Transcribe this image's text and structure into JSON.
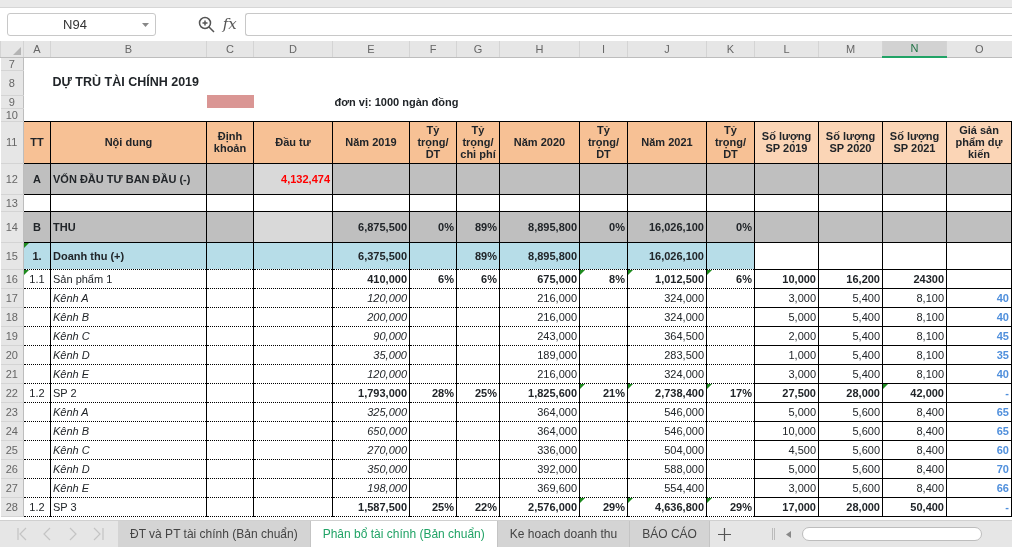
{
  "name_box": {
    "value": "N94"
  },
  "formula_bar": {
    "fx_label": "fx"
  },
  "columns": [
    {
      "label": "A",
      "selected": false
    },
    {
      "label": "B",
      "selected": false
    },
    {
      "label": "C",
      "selected": false
    },
    {
      "label": "D",
      "selected": false
    },
    {
      "label": "E",
      "selected": false
    },
    {
      "label": "F",
      "selected": false
    },
    {
      "label": "G",
      "selected": false
    },
    {
      "label": "H",
      "selected": false
    },
    {
      "label": "I",
      "selected": false
    },
    {
      "label": "J",
      "selected": false
    },
    {
      "label": "K",
      "selected": false
    },
    {
      "label": "L",
      "selected": false
    },
    {
      "label": "M",
      "selected": false
    },
    {
      "label": "N",
      "selected": true
    },
    {
      "label": "O",
      "selected": false
    }
  ],
  "rows": [
    {
      "number": "7",
      "kind": "spacer"
    },
    {
      "number": "8",
      "kind": "title",
      "text": "DỰ TRÙ TÀI CHÍNH 2019"
    },
    {
      "number": "9",
      "kind": "note",
      "text": "đơn vị: 1000 ngàn đồng"
    },
    {
      "number": "10",
      "kind": "spacer"
    },
    {
      "number": "11",
      "kind": "header",
      "cells": [
        {
          "text": "TT",
          "kind": "main"
        },
        {
          "text": "Nội dung",
          "kind": "main"
        },
        {
          "text": "Định khoản",
          "kind": "main"
        },
        {
          "text": "Đầu tư",
          "kind": "main"
        },
        {
          "text": "Năm 2019",
          "kind": "main"
        },
        {
          "text": "Tỷ trọng/ DT",
          "kind": "main"
        },
        {
          "text": "Tỷ trọng/ chi phí",
          "kind": "main"
        },
        {
          "text": "Năm 2020",
          "kind": "main"
        },
        {
          "text": "Tỷ trọng/ DT",
          "kind": "main"
        },
        {
          "text": "Năm 2021",
          "kind": "main"
        },
        {
          "text": "Tỷ trọng/ DT",
          "kind": "main"
        },
        {
          "text": "Số lượng SP 2019",
          "kind": "count"
        },
        {
          "text": "Số lượng SP 2020",
          "kind": "count"
        },
        {
          "text": "Số lượng SP 2021",
          "kind": "count"
        },
        {
          "text": "Giá sản phẩm dự kiến",
          "kind": "count"
        }
      ]
    },
    {
      "number": "12",
      "kind": "section",
      "cells": {
        "A": "A",
        "B": "VỐN ĐẦU TƯ BAN ĐẦU (-)",
        "D": "4,132,474"
      },
      "red": {
        "D": true
      }
    },
    {
      "number": "13",
      "kind": "blank",
      "cells": {}
    },
    {
      "number": "14",
      "kind": "section",
      "cells": {
        "A": "B",
        "B": "THU",
        "E": "6,875,500",
        "F": "0%",
        "G": "89%",
        "H": "8,895,800",
        "I": "0%",
        "J": "16,026,100",
        "K": "0%"
      }
    },
    {
      "number": "15",
      "kind": "subtotal",
      "cells": {
        "A": "1.",
        "B": "Doanh thu (+)",
        "E": "6,375,500",
        "G": "89%",
        "H": "8,895,800",
        "J": "16,026,100"
      },
      "flagged": {
        "A": true
      }
    },
    {
      "number": "16",
      "kind": "product",
      "cells": {
        "A": "1.1",
        "B": "Sản phẩm 1",
        "E": "410,000",
        "F": "6%",
        "G": "6%",
        "H": "675,000",
        "I": "8%",
        "J": "1,012,500",
        "K": "6%",
        "L": "10,000",
        "M": "16,200",
        "N": "24300"
      },
      "flagged": {
        "A": true,
        "I": true,
        "J": true,
        "K": true
      }
    },
    {
      "number": "17",
      "kind": "channel",
      "cells": {
        "B": "Kênh A",
        "E": "120,000",
        "H": "216,000",
        "J": "324,000",
        "L": "3,000",
        "M": "5,400",
        "N": "8,100",
        "O": "40"
      }
    },
    {
      "number": "18",
      "kind": "channel",
      "cells": {
        "B": "Kênh B",
        "E": "200,000",
        "H": "216,000",
        "J": "324,000",
        "L": "5,000",
        "M": "5,400",
        "N": "8,100",
        "O": "40"
      }
    },
    {
      "number": "19",
      "kind": "channel",
      "cells": {
        "B": "Kênh C",
        "E": "90,000",
        "H": "243,000",
        "J": "364,500",
        "L": "2,000",
        "M": "5,400",
        "N": "8,100",
        "O": "45"
      }
    },
    {
      "number": "20",
      "kind": "channel",
      "cells": {
        "B": "Kênh D",
        "E": "35,000",
        "H": "189,000",
        "J": "283,500",
        "L": "1,000",
        "M": "5,400",
        "N": "8,100",
        "O": "35"
      }
    },
    {
      "number": "21",
      "kind": "channel",
      "cells": {
        "B": "Kênh E",
        "E": "120,000",
        "H": "216,000",
        "J": "324,000",
        "L": "3,000",
        "M": "5,400",
        "N": "8,100",
        "O": "40"
      }
    },
    {
      "number": "22",
      "kind": "product",
      "cells": {
        "A": "1.2",
        "B": "SP 2",
        "E": "1,793,000",
        "F": "28%",
        "G": "25%",
        "H": "1,825,600",
        "I": "21%",
        "J": "2,738,400",
        "K": "17%",
        "L": "27,500",
        "M": "28,000",
        "N": "42,000",
        "O": "-"
      },
      "flagged": {
        "I": true,
        "J": true,
        "K": true,
        "N": true
      }
    },
    {
      "number": "23",
      "kind": "channel",
      "cells": {
        "B": "Kênh A",
        "E": "325,000",
        "H": "364,000",
        "J": "546,000",
        "L": "5,000",
        "M": "5,600",
        "N": "8,400",
        "O": "65"
      }
    },
    {
      "number": "24",
      "kind": "channel",
      "cells": {
        "B": "Kênh B",
        "E": "650,000",
        "H": "364,000",
        "J": "546,000",
        "L": "10,000",
        "M": "5,600",
        "N": "8,400",
        "O": "65"
      }
    },
    {
      "number": "25",
      "kind": "channel",
      "cells": {
        "B": "Kênh C",
        "E": "270,000",
        "H": "336,000",
        "J": "504,000",
        "L": "4,500",
        "M": "5,600",
        "N": "8,400",
        "O": "60"
      }
    },
    {
      "number": "26",
      "kind": "channel",
      "cells": {
        "B": "Kênh D",
        "E": "350,000",
        "H": "392,000",
        "J": "588,000",
        "L": "5,000",
        "M": "5,600",
        "N": "8,400",
        "O": "70"
      }
    },
    {
      "number": "27",
      "kind": "channel",
      "cells": {
        "B": "Kênh E",
        "E": "198,000",
        "H": "369,600",
        "J": "554,400",
        "L": "3,000",
        "M": "5,600",
        "N": "8,400",
        "O": "66"
      }
    },
    {
      "number": "28",
      "kind": "product",
      "cells": {
        "A": "1.2",
        "B": "SP 3",
        "E": "1,587,500",
        "F": "25%",
        "G": "22%",
        "H": "2,576,000",
        "I": "29%",
        "J": "4,636,800",
        "K": "29%",
        "L": "17,000",
        "M": "28,000",
        "N": "50,400",
        "O": "-"
      },
      "flagged": {
        "I": true,
        "J": true,
        "K": true
      }
    }
  ],
  "sheet_nav": {
    "disabled": true
  },
  "sheet_tabs": [
    {
      "label": "ĐT và PT tài chính (Bản chuẩn)",
      "selected": false
    },
    {
      "label": "Phân bổ tài chính (Bản chuẩn)",
      "selected": true
    },
    {
      "label": "Ke hoach doanh thu",
      "selected": false
    },
    {
      "label": "BÁO CÁO",
      "selected": false
    }
  ]
}
